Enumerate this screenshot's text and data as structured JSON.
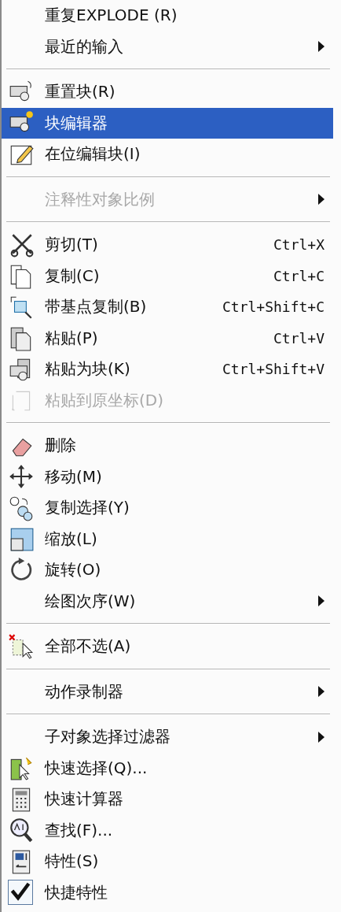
{
  "menu": {
    "items": [
      {
        "kind": "item",
        "label": "重复EXPLODE (R)",
        "selected": false,
        "disabled": false,
        "submenu": false
      },
      {
        "kind": "item",
        "label": "最近的输入",
        "selected": false,
        "disabled": false,
        "submenu": true
      },
      {
        "kind": "separator"
      },
      {
        "kind": "item",
        "label": "重置块(R)",
        "selected": false,
        "disabled": false,
        "submenu": false
      },
      {
        "kind": "item",
        "label": "块编辑器",
        "selected": true,
        "disabled": false,
        "submenu": false
      },
      {
        "kind": "item",
        "label": "在位编辑块(I)",
        "selected": false,
        "disabled": false,
        "submenu": false
      },
      {
        "kind": "separator"
      },
      {
        "kind": "item",
        "label": "注释性对象比例",
        "selected": false,
        "disabled": true,
        "submenu": true
      },
      {
        "kind": "separator"
      },
      {
        "kind": "item",
        "label": "剪切(T)",
        "shortcut": "Ctrl+X",
        "selected": false,
        "disabled": false,
        "submenu": false
      },
      {
        "kind": "item",
        "label": "复制(C)",
        "shortcut": "Ctrl+C",
        "selected": false,
        "disabled": false,
        "submenu": false
      },
      {
        "kind": "item",
        "label": "带基点复制(B)",
        "shortcut": "Ctrl+Shift+C",
        "selected": false,
        "disabled": false,
        "submenu": false
      },
      {
        "kind": "item",
        "label": "粘贴(P)",
        "shortcut": "Ctrl+V",
        "selected": false,
        "disabled": false,
        "submenu": false
      },
      {
        "kind": "item",
        "label": "粘贴为块(K)",
        "shortcut": "Ctrl+Shift+V",
        "selected": false,
        "disabled": false,
        "submenu": false
      },
      {
        "kind": "item",
        "label": "粘贴到原坐标(D)",
        "selected": false,
        "disabled": true,
        "submenu": false
      },
      {
        "kind": "separator"
      },
      {
        "kind": "item",
        "label": "删除",
        "selected": false,
        "disabled": false,
        "submenu": false
      },
      {
        "kind": "item",
        "label": "移动(M)",
        "selected": false,
        "disabled": false,
        "submenu": false
      },
      {
        "kind": "item",
        "label": "复制选择(Y)",
        "selected": false,
        "disabled": false,
        "submenu": false
      },
      {
        "kind": "item",
        "label": "缩放(L)",
        "selected": false,
        "disabled": false,
        "submenu": false
      },
      {
        "kind": "item",
        "label": "旋转(O)",
        "selected": false,
        "disabled": false,
        "submenu": false
      },
      {
        "kind": "item",
        "label": "绘图次序(W)",
        "selected": false,
        "disabled": false,
        "submenu": true
      },
      {
        "kind": "separator"
      },
      {
        "kind": "item",
        "label": "全部不选(A)",
        "selected": false,
        "disabled": false,
        "submenu": false
      },
      {
        "kind": "separator"
      },
      {
        "kind": "item",
        "label": "动作录制器",
        "selected": false,
        "disabled": false,
        "submenu": true
      },
      {
        "kind": "separator"
      },
      {
        "kind": "item",
        "label": "子对象选择过滤器",
        "selected": false,
        "disabled": false,
        "submenu": true
      },
      {
        "kind": "item",
        "label": "快速选择(Q)...",
        "selected": false,
        "disabled": false,
        "submenu": false
      },
      {
        "kind": "item",
        "label": "快速计算器",
        "selected": false,
        "disabled": false,
        "submenu": false
      },
      {
        "kind": "item",
        "label": "查找(F)...",
        "selected": false,
        "disabled": false,
        "submenu": false
      },
      {
        "kind": "item",
        "label": "特性(S)",
        "selected": false,
        "disabled": false,
        "submenu": false
      },
      {
        "kind": "item",
        "label": "快捷特性",
        "selected": false,
        "disabled": false,
        "submenu": false,
        "checked": true
      }
    ]
  }
}
